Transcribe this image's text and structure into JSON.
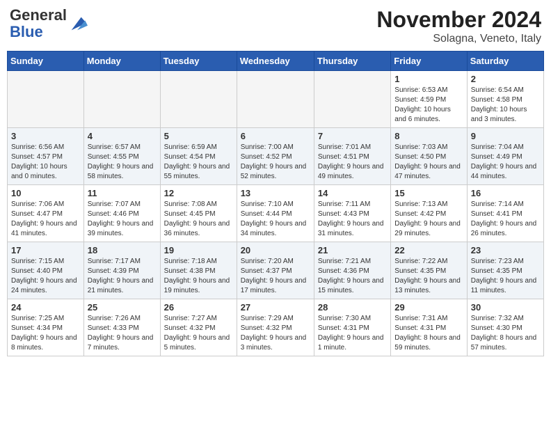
{
  "header": {
    "logo_line1": "General",
    "logo_line2": "Blue",
    "month": "November 2024",
    "location": "Solagna, Veneto, Italy"
  },
  "weekdays": [
    "Sunday",
    "Monday",
    "Tuesday",
    "Wednesday",
    "Thursday",
    "Friday",
    "Saturday"
  ],
  "weeks": [
    [
      {
        "day": "",
        "info": ""
      },
      {
        "day": "",
        "info": ""
      },
      {
        "day": "",
        "info": ""
      },
      {
        "day": "",
        "info": ""
      },
      {
        "day": "",
        "info": ""
      },
      {
        "day": "1",
        "info": "Sunrise: 6:53 AM\nSunset: 4:59 PM\nDaylight: 10 hours and 6 minutes."
      },
      {
        "day": "2",
        "info": "Sunrise: 6:54 AM\nSunset: 4:58 PM\nDaylight: 10 hours and 3 minutes."
      }
    ],
    [
      {
        "day": "3",
        "info": "Sunrise: 6:56 AM\nSunset: 4:57 PM\nDaylight: 10 hours and 0 minutes."
      },
      {
        "day": "4",
        "info": "Sunrise: 6:57 AM\nSunset: 4:55 PM\nDaylight: 9 hours and 58 minutes."
      },
      {
        "day": "5",
        "info": "Sunrise: 6:59 AM\nSunset: 4:54 PM\nDaylight: 9 hours and 55 minutes."
      },
      {
        "day": "6",
        "info": "Sunrise: 7:00 AM\nSunset: 4:52 PM\nDaylight: 9 hours and 52 minutes."
      },
      {
        "day": "7",
        "info": "Sunrise: 7:01 AM\nSunset: 4:51 PM\nDaylight: 9 hours and 49 minutes."
      },
      {
        "day": "8",
        "info": "Sunrise: 7:03 AM\nSunset: 4:50 PM\nDaylight: 9 hours and 47 minutes."
      },
      {
        "day": "9",
        "info": "Sunrise: 7:04 AM\nSunset: 4:49 PM\nDaylight: 9 hours and 44 minutes."
      }
    ],
    [
      {
        "day": "10",
        "info": "Sunrise: 7:06 AM\nSunset: 4:47 PM\nDaylight: 9 hours and 41 minutes."
      },
      {
        "day": "11",
        "info": "Sunrise: 7:07 AM\nSunset: 4:46 PM\nDaylight: 9 hours and 39 minutes."
      },
      {
        "day": "12",
        "info": "Sunrise: 7:08 AM\nSunset: 4:45 PM\nDaylight: 9 hours and 36 minutes."
      },
      {
        "day": "13",
        "info": "Sunrise: 7:10 AM\nSunset: 4:44 PM\nDaylight: 9 hours and 34 minutes."
      },
      {
        "day": "14",
        "info": "Sunrise: 7:11 AM\nSunset: 4:43 PM\nDaylight: 9 hours and 31 minutes."
      },
      {
        "day": "15",
        "info": "Sunrise: 7:13 AM\nSunset: 4:42 PM\nDaylight: 9 hours and 29 minutes."
      },
      {
        "day": "16",
        "info": "Sunrise: 7:14 AM\nSunset: 4:41 PM\nDaylight: 9 hours and 26 minutes."
      }
    ],
    [
      {
        "day": "17",
        "info": "Sunrise: 7:15 AM\nSunset: 4:40 PM\nDaylight: 9 hours and 24 minutes."
      },
      {
        "day": "18",
        "info": "Sunrise: 7:17 AM\nSunset: 4:39 PM\nDaylight: 9 hours and 21 minutes."
      },
      {
        "day": "19",
        "info": "Sunrise: 7:18 AM\nSunset: 4:38 PM\nDaylight: 9 hours and 19 minutes."
      },
      {
        "day": "20",
        "info": "Sunrise: 7:20 AM\nSunset: 4:37 PM\nDaylight: 9 hours and 17 minutes."
      },
      {
        "day": "21",
        "info": "Sunrise: 7:21 AM\nSunset: 4:36 PM\nDaylight: 9 hours and 15 minutes."
      },
      {
        "day": "22",
        "info": "Sunrise: 7:22 AM\nSunset: 4:35 PM\nDaylight: 9 hours and 13 minutes."
      },
      {
        "day": "23",
        "info": "Sunrise: 7:23 AM\nSunset: 4:35 PM\nDaylight: 9 hours and 11 minutes."
      }
    ],
    [
      {
        "day": "24",
        "info": "Sunrise: 7:25 AM\nSunset: 4:34 PM\nDaylight: 9 hours and 8 minutes."
      },
      {
        "day": "25",
        "info": "Sunrise: 7:26 AM\nSunset: 4:33 PM\nDaylight: 9 hours and 7 minutes."
      },
      {
        "day": "26",
        "info": "Sunrise: 7:27 AM\nSunset: 4:32 PM\nDaylight: 9 hours and 5 minutes."
      },
      {
        "day": "27",
        "info": "Sunrise: 7:29 AM\nSunset: 4:32 PM\nDaylight: 9 hours and 3 minutes."
      },
      {
        "day": "28",
        "info": "Sunrise: 7:30 AM\nSunset: 4:31 PM\nDaylight: 9 hours and 1 minute."
      },
      {
        "day": "29",
        "info": "Sunrise: 7:31 AM\nSunset: 4:31 PM\nDaylight: 8 hours and 59 minutes."
      },
      {
        "day": "30",
        "info": "Sunrise: 7:32 AM\nSunset: 4:30 PM\nDaylight: 8 hours and 57 minutes."
      }
    ]
  ]
}
